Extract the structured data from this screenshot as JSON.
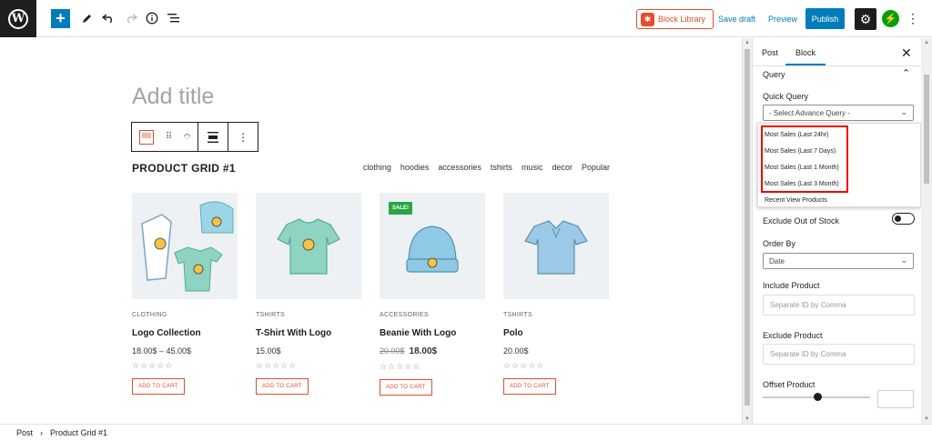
{
  "topbar": {
    "block_library_label": "Block Library",
    "save_draft_label": "Save draft",
    "preview_label": "Preview",
    "publish_label": "Publish"
  },
  "editor": {
    "title_placeholder": "Add title",
    "grid_title": "PRODUCT GRID #1",
    "filters": [
      "clothing",
      "hoodies",
      "accessories",
      "tshirts",
      "music",
      "decor",
      "Popular"
    ],
    "products": [
      {
        "category": "CLOTHING",
        "name": "Logo Collection",
        "price": "18.00$ – 45.00$",
        "old_price": "",
        "sale": "",
        "stars": "☆☆☆☆☆",
        "cart": "ADD TO CART",
        "color": "#8fd3c2"
      },
      {
        "category": "TSHIRTS",
        "name": "T-Shirt With Logo",
        "price": "15.00$",
        "old_price": "",
        "sale": "",
        "stars": "☆☆☆☆☆",
        "cart": "ADD TO CART",
        "color": "#8fd3c2"
      },
      {
        "category": "ACCESSORIES",
        "name": "Beanie With Logo",
        "price": "18.00$",
        "old_price": "20.00$",
        "sale": "SALE!",
        "stars": "☆☆☆☆☆",
        "cart": "ADD TO CART",
        "color": "#8ecae6"
      },
      {
        "category": "TSHIRTS",
        "name": "Polo",
        "price": "20.00$",
        "old_price": "",
        "sale": "",
        "stars": "☆☆☆☆☆",
        "cart": "ADD TO CART",
        "color": "#9cc9e8"
      }
    ]
  },
  "sidebar": {
    "tab_post": "Post",
    "tab_block": "Block",
    "section_query": "Query",
    "quick_query_label": "Quick Query",
    "quick_query_value": "- Select Advance Query -",
    "dropdown_items": [
      "Most Sales (Last 24hr)",
      "Most Sales (Last 7 Days)",
      "Most Sales (Last 1 Month)",
      "Most Sales (Last 3 Month)",
      "Recent View Products"
    ],
    "exclude_stock_label": "Exclude Out of Stock",
    "order_by_label": "Order By",
    "order_by_value": "Date",
    "include_label": "Include Product",
    "include_placeholder": "Separate ID by Comma",
    "exclude_label": "Exclude Product",
    "exclude_placeholder": "Separate ID by Comma",
    "offset_label": "Offset Product"
  },
  "footer": {
    "crumb_post": "Post",
    "crumb_block": "Product Grid #1"
  },
  "colors": {
    "accent": "#007cba",
    "brand": "#e44d2e",
    "highlight": "#ee0000"
  }
}
